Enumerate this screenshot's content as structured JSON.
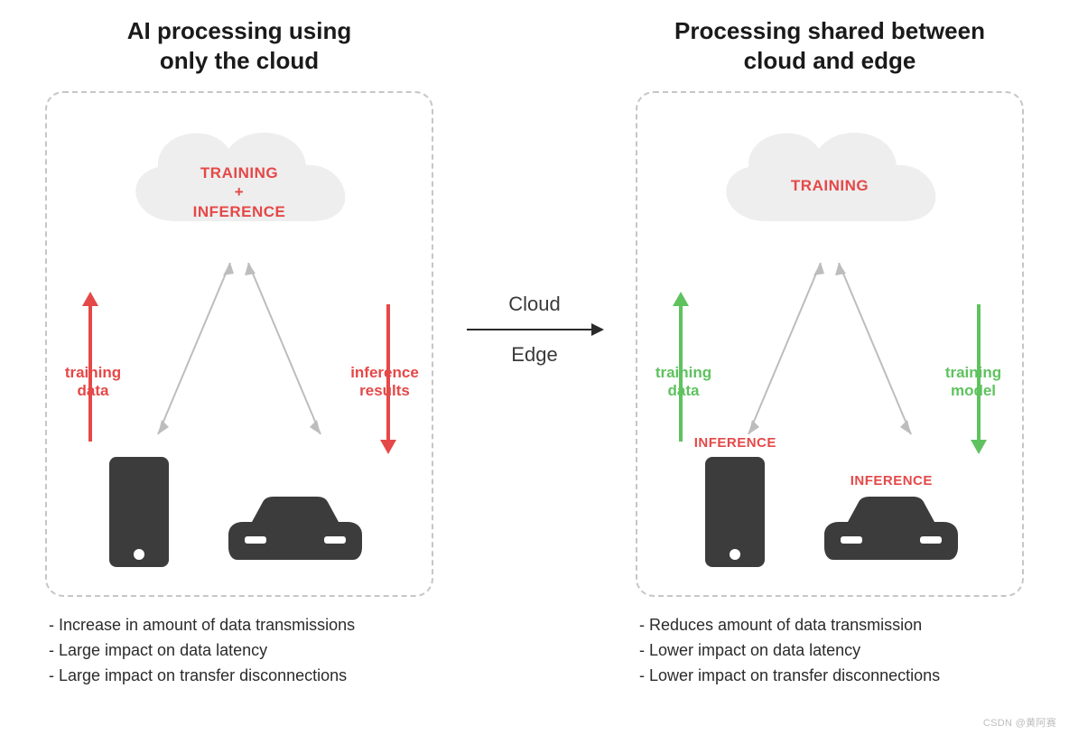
{
  "colors": {
    "accent_red": "#e54848",
    "accent_green": "#5fc25f",
    "cloud_fill": "#eeeeee",
    "device_fill": "#3c3c3c"
  },
  "left": {
    "title": "AI processing using\nonly the cloud",
    "cloud_label": "TRAINING\n+\nINFERENCE",
    "arrow_left_label": "training\ndata",
    "arrow_right_label": "inference\nresults",
    "bullets": [
      "- Increase in amount of data transmissions",
      "- Large impact on data latency",
      "- Large impact on transfer disconnections"
    ]
  },
  "right": {
    "title": "Processing shared between\ncloud and edge",
    "cloud_label": "TRAINING",
    "arrow_left_label": "training\ndata",
    "arrow_right_label": "training\nmodel",
    "phone_label": "INFERENCE",
    "car_label": "INFERENCE",
    "bullets": [
      "- Reduces amount of data transmission",
      "- Lower impact on data latency",
      "- Lower impact on transfer disconnections"
    ]
  },
  "center": {
    "top_label": "Cloud",
    "bottom_label": "Edge"
  },
  "watermark": "CSDN @黄阿赛"
}
